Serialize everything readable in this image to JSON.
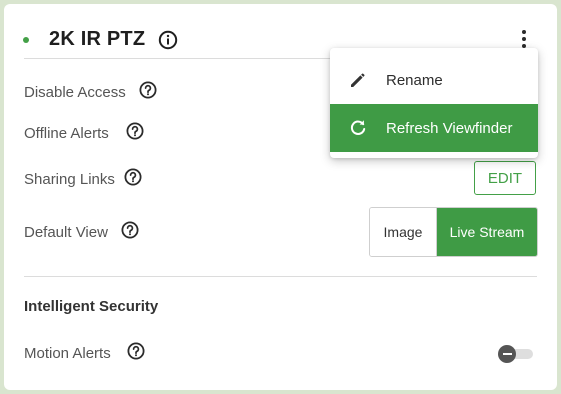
{
  "colors": {
    "accent_green": "#3f9b45",
    "status_online": "#43a047",
    "page_background": "#d9e5cf"
  },
  "header": {
    "camera_name": "2K IR PTZ",
    "status_icon": "status-dot-icon",
    "info_icon": "info-icon",
    "menu_icon": "kebab-menu-icon"
  },
  "settings": {
    "disable_access": {
      "label": "Disable Access"
    },
    "offline_alerts": {
      "label": "Offline Alerts"
    },
    "sharing_links": {
      "label": "Sharing Links",
      "button_label": "EDIT"
    },
    "default_view": {
      "label": "Default View",
      "options": [
        "Image",
        "Live Stream"
      ],
      "selected": "Live Stream"
    }
  },
  "intelligent_security": {
    "title": "Intelligent Security",
    "motion_alerts": {
      "label": "Motion Alerts",
      "enabled": false
    }
  },
  "context_menu": {
    "items": [
      {
        "label": "Rename",
        "icon": "pencil-icon",
        "highlighted": false
      },
      {
        "label": "Refresh Viewfinder",
        "icon": "refresh-icon",
        "highlighted": true
      }
    ]
  }
}
